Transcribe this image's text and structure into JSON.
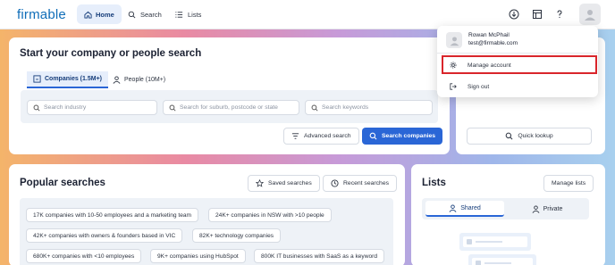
{
  "topbar": {
    "logo": "firmable",
    "nav": {
      "home": "Home",
      "search": "Search",
      "lists": "Lists"
    }
  },
  "search_card": {
    "title": "Start your company or people search",
    "tabs": {
      "companies": "Companies (1.5M+)",
      "people": "People (10M+)"
    },
    "inputs": {
      "industry_placeholder": "Search industry",
      "suburb_placeholder": "Search for suburb, postcode or state",
      "keywords_placeholder": "Search keywords"
    },
    "advanced_label": "Advanced search",
    "submit_label": "Search companies"
  },
  "quick": {
    "label": "Quick lookup"
  },
  "popular": {
    "title": "Popular searches",
    "saved_label": "Saved searches",
    "recent_label": "Recent searches",
    "chips": [
      "17K companies with 10-50 employees and a marketing team",
      "24K+ companies in NSW with >10 people",
      "42K+ companies with owners & founders based in VIC",
      "82K+ technology companies",
      "680K+ companies with <10 employees",
      "9K+ companies using HubSpot",
      "800K IT businesses with SaaS as a keyword"
    ]
  },
  "lists": {
    "title": "Lists",
    "manage_label": "Manage lists",
    "tabs": {
      "shared": "Shared",
      "private": "Private"
    }
  },
  "user_menu": {
    "name": "Rowan McPhail",
    "email": "test@firmable.com",
    "manage_account": "Manage account",
    "sign_out": "Sign out"
  },
  "colors": {
    "accent": "#2a66d6",
    "highlight": "#d9252b",
    "logo": "#0f6db8"
  }
}
